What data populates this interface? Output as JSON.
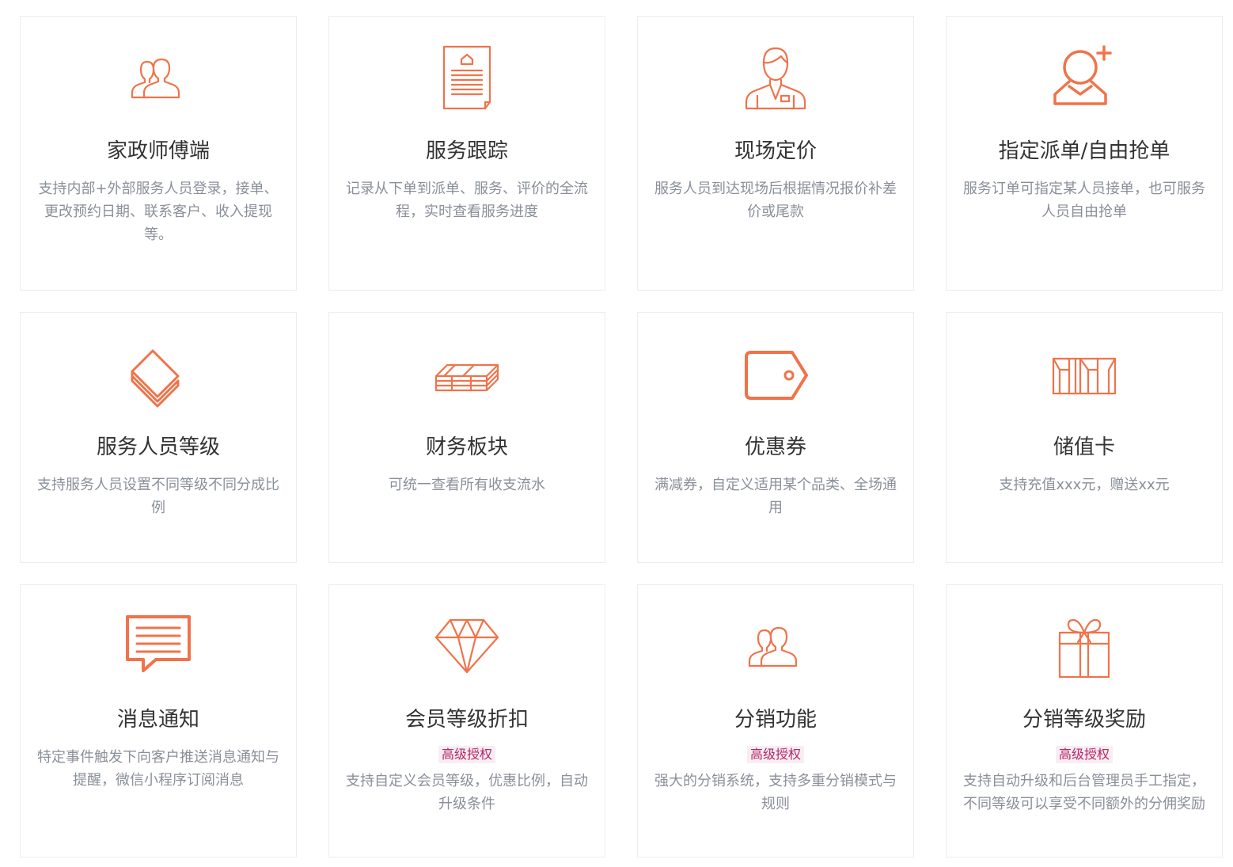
{
  "accent_color": "#f0734a",
  "features": [
    {
      "icon": "users-icon",
      "title": "家政师傅端",
      "desc": "支持内部+外部服务人员登录，接单、更改预约日期、联系客户、收入提现等。"
    },
    {
      "icon": "document-icon",
      "title": "服务跟踪",
      "desc": "记录从下单到派单、服务、评价的全流程，实时查看服务进度"
    },
    {
      "icon": "staff-icon",
      "title": "现场定价",
      "desc": "服务人员到达现场后根据情况报价补差价或尾款"
    },
    {
      "icon": "user-add-icon",
      "title": "指定派单/自由抢单",
      "desc": "服务订单可指定某人员接单，也可服务人员自由抢单"
    },
    {
      "icon": "layers-icon",
      "title": "服务人员等级",
      "desc": "支持服务人员设置不同等级不同分成比例"
    },
    {
      "icon": "money-icon",
      "title": "财务板块",
      "desc": "可统一查看所有收支流水"
    },
    {
      "icon": "tag-icon",
      "title": "优惠券",
      "desc": "满减券，自定义适用某个品类、全场通用"
    },
    {
      "icon": "box-icon",
      "title": "储值卡",
      "desc": "支持充值xxx元，赠送xx元"
    },
    {
      "icon": "message-icon",
      "title": "消息通知",
      "desc": "特定事件触发下向客户推送消息通知与提醒，微信小程序订阅消息"
    },
    {
      "icon": "diamond-icon",
      "title": "会员等级折扣",
      "badge": "高级授权",
      "desc": "支持自定义会员等级，优惠比例，自动升级条件"
    },
    {
      "icon": "users-icon",
      "title": "分销功能",
      "badge": "高级授权",
      "desc": "强大的分销系统，支持多重分销模式与规则"
    },
    {
      "icon": "gift-icon",
      "title": "分销等级奖励",
      "badge": "高级授权",
      "desc": "支持自动升级和后台管理员手工指定，不同等级可以享受不同额外的分佣奖励"
    }
  ]
}
